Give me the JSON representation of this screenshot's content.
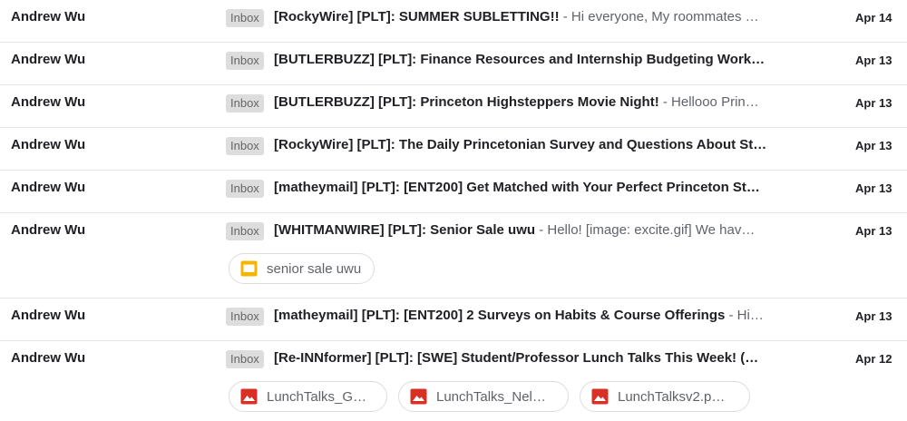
{
  "badge_label": "Inbox",
  "colors": {
    "slides_yellow": "#f4b400",
    "image_red": "#d93025"
  },
  "emails": [
    {
      "sender": "Andrew Wu",
      "subject": "[RockyWire] [PLT]: SUMMER SUBLETTING!!",
      "snippet": " - Hi everyone, My roommates …",
      "date": "Apr 14"
    },
    {
      "sender": "Andrew Wu",
      "subject": "[BUTLERBUZZ] [PLT]: Finance Resources and Internship Budgeting Work…",
      "snippet": "",
      "date": "Apr 13"
    },
    {
      "sender": "Andrew Wu",
      "subject": "[BUTLERBUZZ] [PLT]: Princeton Highsteppers Movie Night!",
      "snippet": " - Hellooo Prin…",
      "date": "Apr 13"
    },
    {
      "sender": "Andrew Wu",
      "subject": "[RockyWire] [PLT]: The Daily Princetonian Survey and Questions About St…",
      "snippet": "",
      "date": "Apr 13"
    },
    {
      "sender": "Andrew Wu",
      "subject": "[matheymail] [PLT]: [ENT200] Get Matched with Your Perfect Princeton St…",
      "snippet": "",
      "date": "Apr 13"
    },
    {
      "sender": "Andrew Wu",
      "subject": "[WHITMANWIRE] [PLT]: Senior Sale uwu",
      "snippet": " - Hello! [image: excite.gif] We hav…",
      "date": "Apr 13",
      "attachments": [
        {
          "label": "senior sale uwu",
          "icon": "slides-icon"
        }
      ]
    },
    {
      "sender": "Andrew Wu",
      "subject": "[matheymail] [PLT]: [ENT200] 2 Surveys on Habits & Course Offerings",
      "snippet": " - Hi…",
      "date": "Apr 13"
    },
    {
      "sender": "Andrew Wu",
      "subject": "[Re-INNformer] [PLT]: [SWE] Student/Professor Lunch Talks This Week! (…",
      "snippet": "",
      "date": "Apr 12",
      "attachments": [
        {
          "label": "LunchTalks_Gm…",
          "icon": "image-icon"
        },
        {
          "label": "LunchTalks_Nel…",
          "icon": "image-icon"
        },
        {
          "label": "LunchTalksv2.p…",
          "icon": "image-icon"
        }
      ]
    }
  ]
}
